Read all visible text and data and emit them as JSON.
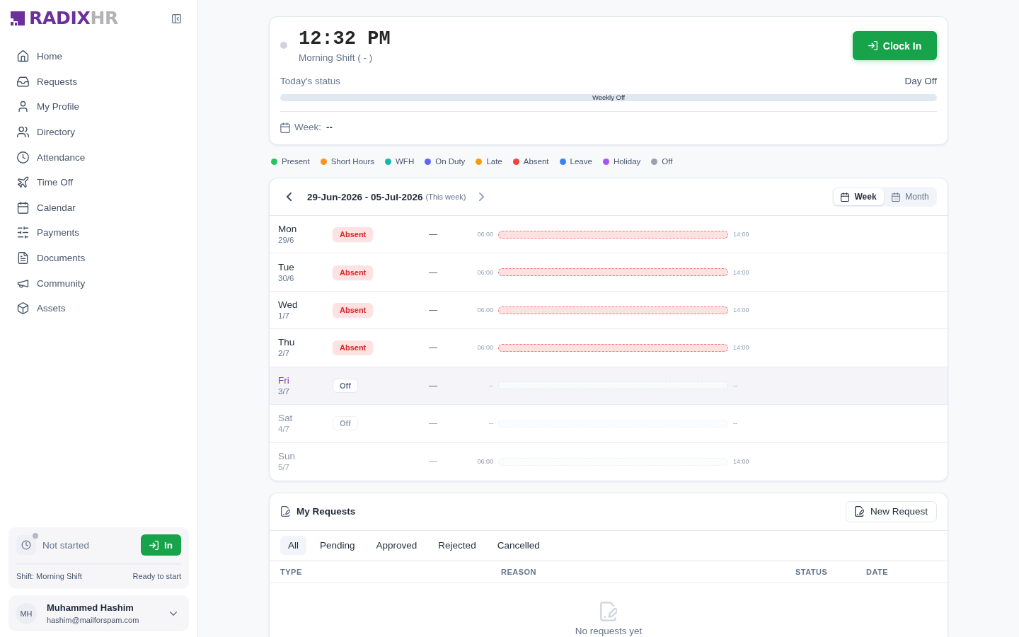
{
  "sidebar": {
    "brand": {
      "primary": "RADIX",
      "secondary": "HR"
    },
    "nav": [
      {
        "label": "Home",
        "selected": false
      },
      {
        "label": "Requests",
        "selected": false
      },
      {
        "label": "My Profile",
        "selected": false
      },
      {
        "label": "Directory",
        "selected": false
      },
      {
        "label": "Attendance",
        "selected": false
      },
      {
        "label": "Time Off",
        "selected": false
      },
      {
        "label": "Calendar",
        "selected": false
      },
      {
        "label": "Payments",
        "selected": false
      },
      {
        "label": "Documents",
        "selected": false
      },
      {
        "label": "Community",
        "selected": false
      },
      {
        "label": "Assets",
        "selected": false
      }
    ],
    "shift_widget": {
      "status": "Not started",
      "button": "In",
      "shift": "Shift: Morning Shift",
      "note": "Ready to start"
    },
    "user": {
      "initials": "MH",
      "name": "Muhammed Hashim",
      "email": "hashim@mailforspam.com"
    }
  },
  "clock_card": {
    "time": "12:32 PM",
    "shift": "Morning Shift ( - )",
    "button": "Clock In",
    "status_label": "Today's status",
    "status_value": "Day Off",
    "bar_label": "Weekly Off",
    "week_label": "Week:",
    "week_value": "--"
  },
  "legend": [
    {
      "label": "Present",
      "color": "#22c55e"
    },
    {
      "label": "Short Hours",
      "color": "#f7941d"
    },
    {
      "label": "WFH",
      "color": "#14b8a6"
    },
    {
      "label": "On Duty",
      "color": "#6366f1"
    },
    {
      "label": "Late",
      "color": "#f59e0b"
    },
    {
      "label": "Absent",
      "color": "#ef4444"
    },
    {
      "label": "Leave",
      "color": "#3b82f6"
    },
    {
      "label": "Holiday",
      "color": "#a855f7"
    },
    {
      "label": "Off",
      "color": "#9ca3af"
    }
  ],
  "week": {
    "range": "29-Jun-2026 - 05-Jul-2026",
    "range_note": "(This week)",
    "views": [
      {
        "label": "Week",
        "selected": true
      },
      {
        "label": "Month",
        "selected": false
      }
    ],
    "days": [
      {
        "day": "Mon",
        "date": "29/6",
        "status": {
          "label": "Absent",
          "kind": "absent"
        },
        "hours": "—",
        "start": "06:00",
        "end": "14:00",
        "today": false,
        "muted": false
      },
      {
        "day": "Tue",
        "date": "30/6",
        "status": {
          "label": "Absent",
          "kind": "absent"
        },
        "hours": "—",
        "start": "06:00",
        "end": "14:00",
        "today": false,
        "muted": false
      },
      {
        "day": "Wed",
        "date": "1/7",
        "status": {
          "label": "Absent",
          "kind": "absent"
        },
        "hours": "—",
        "start": "06:00",
        "end": "14:00",
        "today": false,
        "muted": false
      },
      {
        "day": "Thu",
        "date": "2/7",
        "status": {
          "label": "Absent",
          "kind": "absent"
        },
        "hours": "—",
        "start": "06:00",
        "end": "14:00",
        "today": false,
        "muted": false
      },
      {
        "day": "Fri",
        "date": "3/7",
        "status": {
          "label": "Off",
          "kind": "off"
        },
        "hours": "—",
        "start": "--",
        "end": "--",
        "today": true,
        "muted": false
      },
      {
        "day": "Sat",
        "date": "4/7",
        "status": {
          "label": "Off",
          "kind": "off"
        },
        "hours": "—",
        "start": "--",
        "end": "--",
        "today": false,
        "muted": true
      },
      {
        "day": "Sun",
        "date": "5/7",
        "hours": "—",
        "start": "06:00",
        "end": "14:00",
        "today": false,
        "muted": true
      }
    ]
  },
  "requests": {
    "title": "My Requests",
    "button": "New Request",
    "tabs": [
      {
        "label": "All",
        "selected": true
      },
      {
        "label": "Pending",
        "selected": false
      },
      {
        "label": "Approved",
        "selected": false
      },
      {
        "label": "Rejected",
        "selected": false
      },
      {
        "label": "Cancelled",
        "selected": false
      }
    ],
    "columns": [
      "TYPE",
      "REASON",
      "STATUS",
      "DATE"
    ],
    "empty": "No requests yet"
  }
}
